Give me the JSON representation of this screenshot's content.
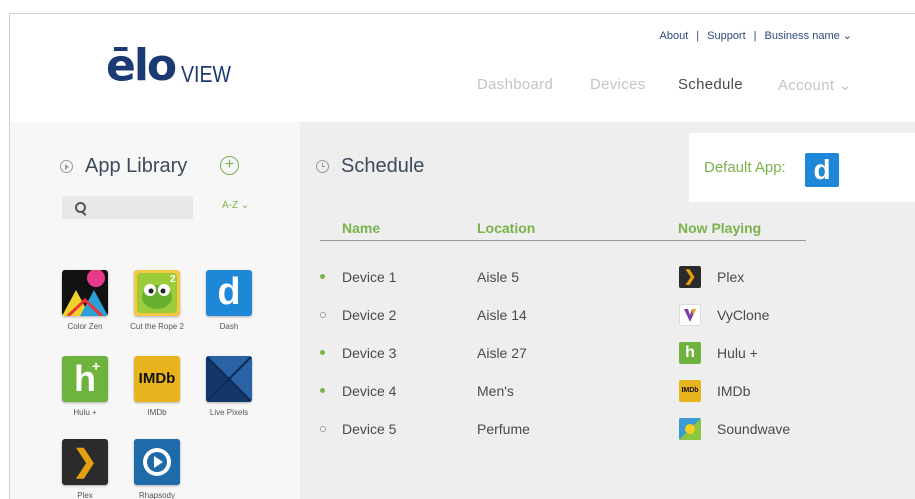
{
  "header": {
    "logo_text": "ēlo",
    "logo_sub": "VIEW",
    "top_links": {
      "about": "About",
      "support": "Support",
      "business": "Business name ⌄",
      "sep": "|"
    },
    "nav": {
      "dashboard": "Dashboard",
      "devices": "Devices",
      "schedule": "Schedule",
      "account": "Account ⌄"
    }
  },
  "app_library": {
    "title": "App Library",
    "add": "+",
    "sort": "A-Z ⌄",
    "search_placeholder": "",
    "apps": [
      {
        "label": "Color Zen"
      },
      {
        "label": "Cut the Rope 2"
      },
      {
        "label": "Dash",
        "glyph": "d"
      },
      {
        "label": "Hulu +",
        "glyph": "h"
      },
      {
        "label": "IMDb",
        "glyph": "IMDb"
      },
      {
        "label": "Live Pixels"
      },
      {
        "label": "Plex",
        "glyph": "❯"
      },
      {
        "label": "Rhapsody",
        "glyph": "C"
      }
    ]
  },
  "schedule": {
    "title": "Schedule",
    "default_label": "Default App:",
    "default_glyph": "d",
    "columns": {
      "name": "Name",
      "location": "Location",
      "now_playing": "Now Playing"
    },
    "rows": [
      {
        "status": "online",
        "name": "Device 1",
        "location": "Aisle 5",
        "app": "Plex"
      },
      {
        "status": "offline",
        "name": "Device 2",
        "location": "Aisle 14",
        "app": "VyClone"
      },
      {
        "status": "online",
        "name": "Device 3",
        "location": "Aisle 27",
        "app": "Hulu +"
      },
      {
        "status": "online",
        "name": "Device 4",
        "location": "Men's",
        "app": "IMDb"
      },
      {
        "status": "offline",
        "name": "Device 5",
        "location": "Perfume",
        "app": "Soundwave"
      }
    ]
  },
  "colors": {
    "brand_navy": "#1b3a73",
    "accent_green": "#7ab24c",
    "dash_blue": "#1e87d8"
  }
}
